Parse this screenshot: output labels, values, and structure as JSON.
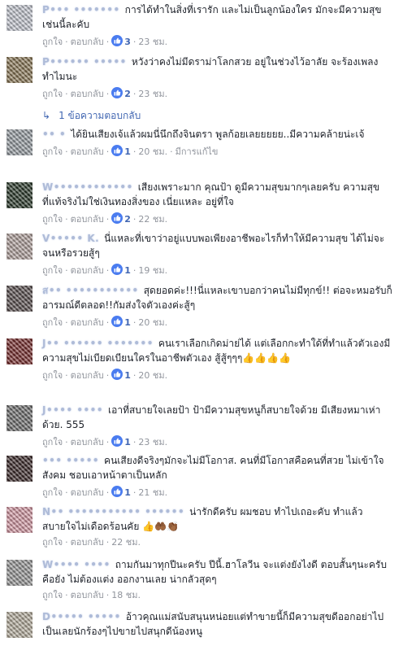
{
  "actions": {
    "like": "ถูกใจ",
    "reply": "ตอบกลับ",
    "edited": "มีการแก้ไข"
  },
  "colors": {
    "blue": "#4267b2",
    "meta": "#90949c",
    "text": "#1d2129"
  },
  "comments": [
    {
      "author": "P••• •••••••",
      "text": "การได้ทำในสิ่งที่เรารัก และไม่เป็นลูกน้องใคร มักจะมีความสุขเช่นนี้ละคับ",
      "likes": "3",
      "time": "23 ชม.",
      "edited": ""
    },
    {
      "author": "P•••••• •••••",
      "text": "หวังว่าคงไม่มีดราม่าโลกสวย อยู่ในช่วงไว้อาลัย จะร้องเพลงทำไมนะ",
      "likes": "2",
      "time": "23 ชม.",
      "edited": ""
    },
    {
      "author": "•• •",
      "text": "ได้ยินเสียงเจ้แล้วผมนี่นึกถึงจินตรา พูลก้อยเลยยยยย..มีความคล้ายน่ะเจ้",
      "likes": "1",
      "time": "20 ชม.",
      "edited": "มีการแก้ไข"
    },
    {
      "author": "W••••••••••••",
      "text": "เสียงเพราะมาก คุณป้า ดูมีความสุขมากๆเลยครับ ความสุขที่แท้จริงไม่ใช่เงินทองสิ่งของ เนี่ยแหละ อยู่ที่ใจ",
      "likes": "2",
      "time": "22 ชม.",
      "edited": ""
    },
    {
      "author": "V••••• K.",
      "text": "นี่แหละที่เขาว่าอยู่แบบพอเพียงอาชีพอะไรก็ทำให้มีความสุข ได้ไม่จะจนหรือรวยสู้ๆ",
      "likes": "1",
      "time": "19 ชม.",
      "edited": ""
    },
    {
      "author": "ส•• •••••••••••",
      "text": "สุดยอดค่ะ!!!นี่แหละเขาบอกว่าคนไม่มีทุกข์!! ต่อจะหมอรับก็อารมณ์ดีตลอด!!กัมส่งใจตัวเองค่ะสู้ๆ",
      "likes": "1",
      "time": "20 ชม.",
      "edited": ""
    },
    {
      "author": "J•• •••••• •••••••",
      "text": "คนเราเลือกเกิดม่าย่ได้ แต่เลือกกะทำใด้ที่ทำแล้วตัวเองมีความสุขไม่เบียดเบียนใครในอาชีพตัวเอง สู้สู้ๆๆๆ👍👍👍👍",
      "likes": "1",
      "time": "20 ชม.",
      "edited": ""
    },
    {
      "author": "J•••• ••••",
      "text": "เอาที่สบายใจเลยป้า ป้ามีความสุขหนูก็สบายใจด้วย มีเสียงหมาเห่าด้วย. 555",
      "likes": "1",
      "time": "23 ชม.",
      "edited": ""
    },
    {
      "author": "••• •••••",
      "text": "คนเสียงดีจริงๆมักจะไม่มีโอกาส. คนที่มีโอกาสคือคนที่สวย ไม่เข้าใจสังคม ชอบเอาหน้าตาเป็นหลัก",
      "likes": "1",
      "time": "21 ชม.",
      "edited": ""
    },
    {
      "author": "N•• ••••••••••• ••••••",
      "text": "น่ารักดีครับ ผมชอบ ทำไปเถอะคับ ทำแล้วสบายใจไม่เดือดร้อนคัย 👍🤲🏾👏🏾",
      "likes": "",
      "time": "22 ชม.",
      "edited": ""
    },
    {
      "author": "W•••• ••••",
      "text": "ถามกันมาทุกปีนะครับ ปีนี้.ฮาโลวีน จะแต่งยังไงดี ตอบสั้นๆนะครับ คือยัง ไม่ต้องแต่ง ออกงานเลย น่ากลัวสุดๆ",
      "likes": "",
      "time": "18 ชม.",
      "edited": ""
    },
    {
      "author": "D••••• •••••",
      "text": "อ้าวคุณแม่สนับสนุนหน่อยแต่ทำขายนี้ก็มีความสุขดีออกอย่าไปเป็นเลยนักร้องๆไปขายไปสนุกดีน้องหนู",
      "likes": "",
      "time": "",
      "edited": ""
    }
  ],
  "reply_thread": {
    "label": "1 ข้อความตอบกลับ",
    "arrow": "↳"
  }
}
